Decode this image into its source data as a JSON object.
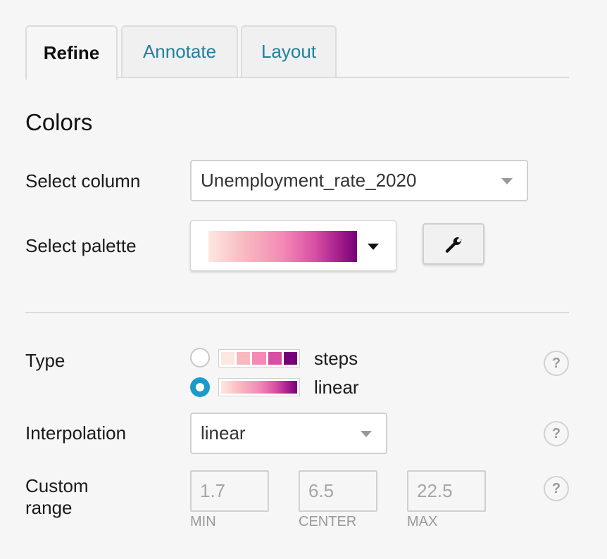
{
  "tabs": [
    {
      "label": "Refine",
      "active": true
    },
    {
      "label": "Annotate",
      "active": false
    },
    {
      "label": "Layout",
      "active": false
    }
  ],
  "colors": {
    "title": "Colors",
    "select_column": {
      "label": "Select column",
      "value": "Unemployment_rate_2020"
    },
    "select_palette": {
      "label": "Select palette",
      "colors": [
        "#fde7e0",
        "#f8b8bf",
        "#f38ab6",
        "#d84ea3",
        "#a51e8c",
        "#760177"
      ],
      "settings_icon": "wrench-icon"
    }
  },
  "type": {
    "label": "Type",
    "options": [
      {
        "label": "steps",
        "selected": false
      },
      {
        "label": "linear",
        "selected": true
      }
    ],
    "help": "?"
  },
  "interpolation": {
    "label": "Interpolation",
    "value": "linear",
    "help": "?"
  },
  "custom_range": {
    "label_line1": "Custom",
    "label_line2": "range",
    "help": "?",
    "min": {
      "placeholder": "1.7",
      "caption": "MIN"
    },
    "center": {
      "placeholder": "6.5",
      "caption": "CENTER"
    },
    "max": {
      "placeholder": "22.5",
      "caption": "MAX"
    }
  },
  "accent_color": "#1a9bc9",
  "tab_link_color": "#1d81a2"
}
